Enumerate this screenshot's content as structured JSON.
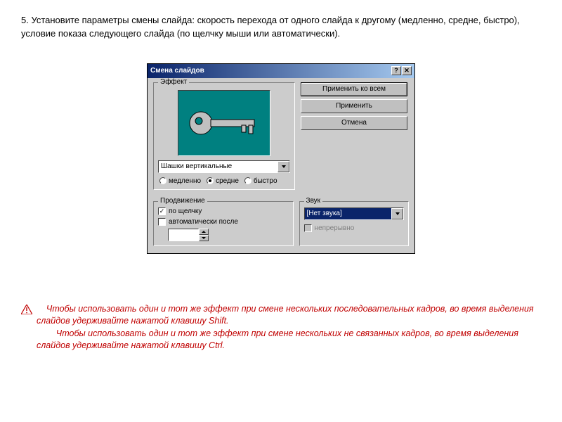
{
  "instruction": "5.  Установите параметры смены слайда: скорость перехода от одного слайда к другому (медленно, средне, быстро), условие показа следующего слайда (по щелчку мыши или автоматически).",
  "dialog": {
    "title": "Смена слайдов",
    "effect_group": "Эффект",
    "effect_value": "Шашки вертикальные",
    "speed": {
      "slow": "медленно",
      "medium": "средне",
      "fast": "быстро"
    },
    "buttons": {
      "apply_all": "Применить ко всем",
      "apply": "Применить",
      "cancel": "Отмена"
    },
    "advance_group": "Продвижение",
    "advance": {
      "on_click": "по щелчку",
      "auto_after": "автоматически после"
    },
    "sound_group": "Звук",
    "sound_value": "[Нет звука]",
    "loop": "непрерывно"
  },
  "note": {
    "p1": "Чтобы использовать один и тот же эффект при смене нескольких последовательных кадров, во время выделения слайдов удерживайте нажатой клавишу Shift.",
    "p2": "Чтобы использовать один и тот же эффект при смене нескольких не связанных кадров, во время выделения слайдов удерживайте нажатой клавишу Ctrl."
  }
}
